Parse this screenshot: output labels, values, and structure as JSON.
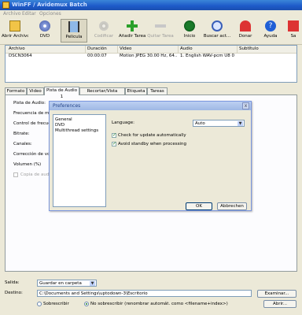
{
  "window": {
    "title": "WinFF / Avidemux Batch"
  },
  "menu": [
    "Archivo",
    "Editar",
    "Opciones"
  ],
  "toolbar": [
    {
      "label": "Abrir Archivo",
      "icon": "folder-icon"
    },
    {
      "label": "DVD",
      "icon": "dvd-icon"
    },
    {
      "label": "Película",
      "icon": "film-icon"
    },
    {
      "label": "Codificar",
      "icon": "encode-icon"
    },
    {
      "label": "Añadir Tarea",
      "icon": "add-icon"
    },
    {
      "label": "Quitar Tarea",
      "icon": "remove-icon"
    },
    {
      "label": "Inicio",
      "icon": "start-icon"
    },
    {
      "label": "Buscar act...",
      "icon": "search-icon"
    },
    {
      "label": "Donar",
      "icon": "donate-icon"
    },
    {
      "label": "Ayuda",
      "icon": "help-icon"
    },
    {
      "label": "Sa",
      "icon": "exit-icon"
    }
  ],
  "tasks": {
    "columns": [
      "Archivo",
      "Duración",
      "Video",
      "Audio",
      "Subtítulo"
    ],
    "rows": [
      [
        "DSCN3064",
        "00:00:07",
        "Motion JPEG 30.00 Hz, 64...",
        "1. English WAV-pcm U8 0 ...",
        ""
      ]
    ]
  },
  "tabs": [
    "Formato",
    "Video",
    "Pista de Audio 1",
    "Recortar/Vista previa",
    "Etiqueta",
    "Tareas"
  ],
  "audio_panel": {
    "labels": [
      "Pista de Audio:",
      "Frecuencia de mues",
      "Control de frecuenc",
      "Bitrate:",
      "Canales:",
      "Corrección de volum",
      "Volumen (%)"
    ],
    "copy_label": "Copia de audio"
  },
  "dialog": {
    "title": "Preferences",
    "close": "x",
    "categories": [
      "General",
      "DVD",
      "Multithread settings"
    ],
    "language_label": "Language:",
    "language_value": "Auto",
    "check_update": "Check for update automatically",
    "avoid_standby": "Avoid standby when processing",
    "ok": "OK",
    "cancel": "Abbrechen"
  },
  "bottom": {
    "output_label": "Salida:",
    "output_value": "Guardar en carpeta",
    "dest_label": "Destino:",
    "dest_value": "C:\\Documents and Settings\\uptodown-3\\Escritorio",
    "browse": "Examinar...",
    "overwrite": "Sobrescribir",
    "no_overwrite": "No sobrescribir (renombrar automát. como <filename+index>)",
    "open": "Abrir..."
  }
}
